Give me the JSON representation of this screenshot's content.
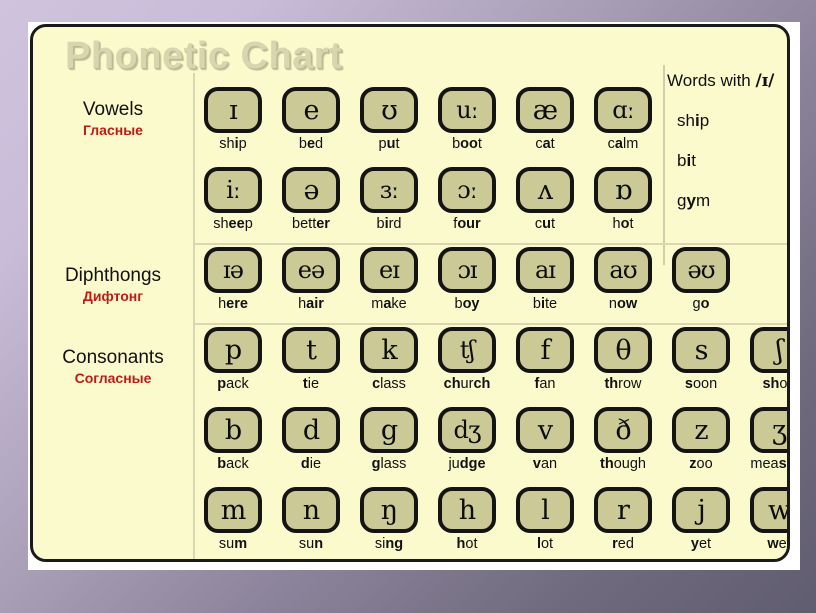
{
  "title": "Phonetic Chart",
  "categories": {
    "vowels": {
      "en": "Vowels",
      "ru": "Гласные"
    },
    "diphthongs": {
      "en": "Diphthongs",
      "ru": "Дифтонг"
    },
    "consonants": {
      "en": "Consonants",
      "ru": "Согласные"
    }
  },
  "side_panel": {
    "title_prefix": "Words with ",
    "title_symbol": "/ɪ/",
    "words": [
      {
        "pre": "sh",
        "bold": "i",
        "post": "p"
      },
      {
        "pre": "b",
        "bold": "i",
        "post": "t"
      },
      {
        "pre": "g",
        "bold": "y",
        "post": "m"
      }
    ]
  },
  "rows": [
    {
      "group": "vowels",
      "cells": [
        {
          "symbol": "ɪ",
          "pre": "sh",
          "bold": "i",
          "post": "p"
        },
        {
          "symbol": "e",
          "pre": "b",
          "bold": "e",
          "post": "d"
        },
        {
          "symbol": "ʊ",
          "pre": "p",
          "bold": "u",
          "post": "t"
        },
        {
          "symbol": "uː",
          "pre": "b",
          "bold": "oo",
          "post": "t"
        },
        {
          "symbol": "æ",
          "pre": "c",
          "bold": "a",
          "post": "t"
        },
        {
          "symbol": "ɑː",
          "pre": "c",
          "bold": "a",
          "post": "lm"
        }
      ]
    },
    {
      "group": "vowels",
      "cells": [
        {
          "symbol": "iː",
          "pre": "sh",
          "bold": "ee",
          "post": "p"
        },
        {
          "symbol": "ə",
          "pre": "bett",
          "bold": "er",
          "post": ""
        },
        {
          "symbol": "ɜː",
          "pre": "b",
          "bold": "i",
          "post": "rd"
        },
        {
          "symbol": "ɔː",
          "pre": "f",
          "bold": "our",
          "post": ""
        },
        {
          "symbol": "ʌ",
          "pre": "c",
          "bold": "u",
          "post": "t"
        },
        {
          "symbol": "ɒ",
          "pre": "h",
          "bold": "o",
          "post": "t"
        }
      ]
    },
    {
      "group": "diphthongs",
      "cells": [
        {
          "symbol": "ɪə",
          "pre": "h",
          "bold": "ere",
          "post": ""
        },
        {
          "symbol": "eə",
          "pre": "h",
          "bold": "air",
          "post": ""
        },
        {
          "symbol": "eɪ",
          "pre": "m",
          "bold": "a",
          "post": "ke"
        },
        {
          "symbol": "ɔɪ",
          "pre": "b",
          "bold": "oy",
          "post": ""
        },
        {
          "symbol": "aɪ",
          "pre": "b",
          "bold": "i",
          "post": "te"
        },
        {
          "symbol": "aʊ",
          "pre": "n",
          "bold": "ow",
          "post": ""
        },
        {
          "symbol": "əʊ",
          "pre": "g",
          "bold": "o",
          "post": ""
        }
      ]
    },
    {
      "group": "consonants",
      "cells": [
        {
          "symbol": "p",
          "pre": "",
          "bold": "p",
          "post": "ack"
        },
        {
          "symbol": "t",
          "pre": "",
          "bold": "t",
          "post": "ie"
        },
        {
          "symbol": "k",
          "pre": "",
          "bold": "c",
          "post": "lass"
        },
        {
          "symbol": "tʃ",
          "pre": "",
          "bold": "ch",
          "post": "ur",
          "post2": "ch"
        },
        {
          "symbol": "f",
          "pre": "",
          "bold": "f",
          "post": "an"
        },
        {
          "symbol": "θ",
          "pre": "",
          "bold": "th",
          "post": "row"
        },
        {
          "symbol": "s",
          "pre": "",
          "bold": "s",
          "post": "oon"
        },
        {
          "symbol": "ʃ",
          "pre": "",
          "bold": "sh",
          "post": "oe"
        }
      ]
    },
    {
      "group": "consonants",
      "cells": [
        {
          "symbol": "b",
          "pre": "",
          "bold": "b",
          "post": "ack"
        },
        {
          "symbol": "d",
          "pre": "",
          "bold": "d",
          "post": "ie"
        },
        {
          "symbol": "g",
          "pre": "",
          "bold": "g",
          "post": "lass"
        },
        {
          "symbol": "dʒ",
          "pre": "ju",
          "bold": "dge",
          "post": ""
        },
        {
          "symbol": "v",
          "pre": "",
          "bold": "v",
          "post": "an"
        },
        {
          "symbol": "ð",
          "pre": "",
          "bold": "th",
          "post": "ough"
        },
        {
          "symbol": "z",
          "pre": "",
          "bold": "z",
          "post": "oo"
        },
        {
          "symbol": "ʒ",
          "pre": "mea",
          "bold": "s",
          "post": "ure"
        }
      ]
    },
    {
      "group": "consonants",
      "cells": [
        {
          "symbol": "m",
          "pre": "su",
          "bold": "m",
          "post": ""
        },
        {
          "symbol": "n",
          "pre": "su",
          "bold": "n",
          "post": ""
        },
        {
          "symbol": "ŋ",
          "pre": "si",
          "bold": "ng",
          "post": ""
        },
        {
          "symbol": "h",
          "pre": "",
          "bold": "h",
          "post": "ot"
        },
        {
          "symbol": "l",
          "pre": "",
          "bold": "l",
          "post": "ot"
        },
        {
          "symbol": "r",
          "pre": "",
          "bold": "r",
          "post": "ed"
        },
        {
          "symbol": "j",
          "pre": "",
          "bold": "y",
          "post": "et"
        },
        {
          "symbol": "w",
          "pre": "",
          "bold": "w",
          "post": "et"
        }
      ]
    }
  ],
  "colors": {
    "card_bg": "#fbfacd",
    "tile_bg": "#cbc995",
    "tile_border": "#141414",
    "russian_label": "#c01a15",
    "title": "#d7d6ae"
  }
}
